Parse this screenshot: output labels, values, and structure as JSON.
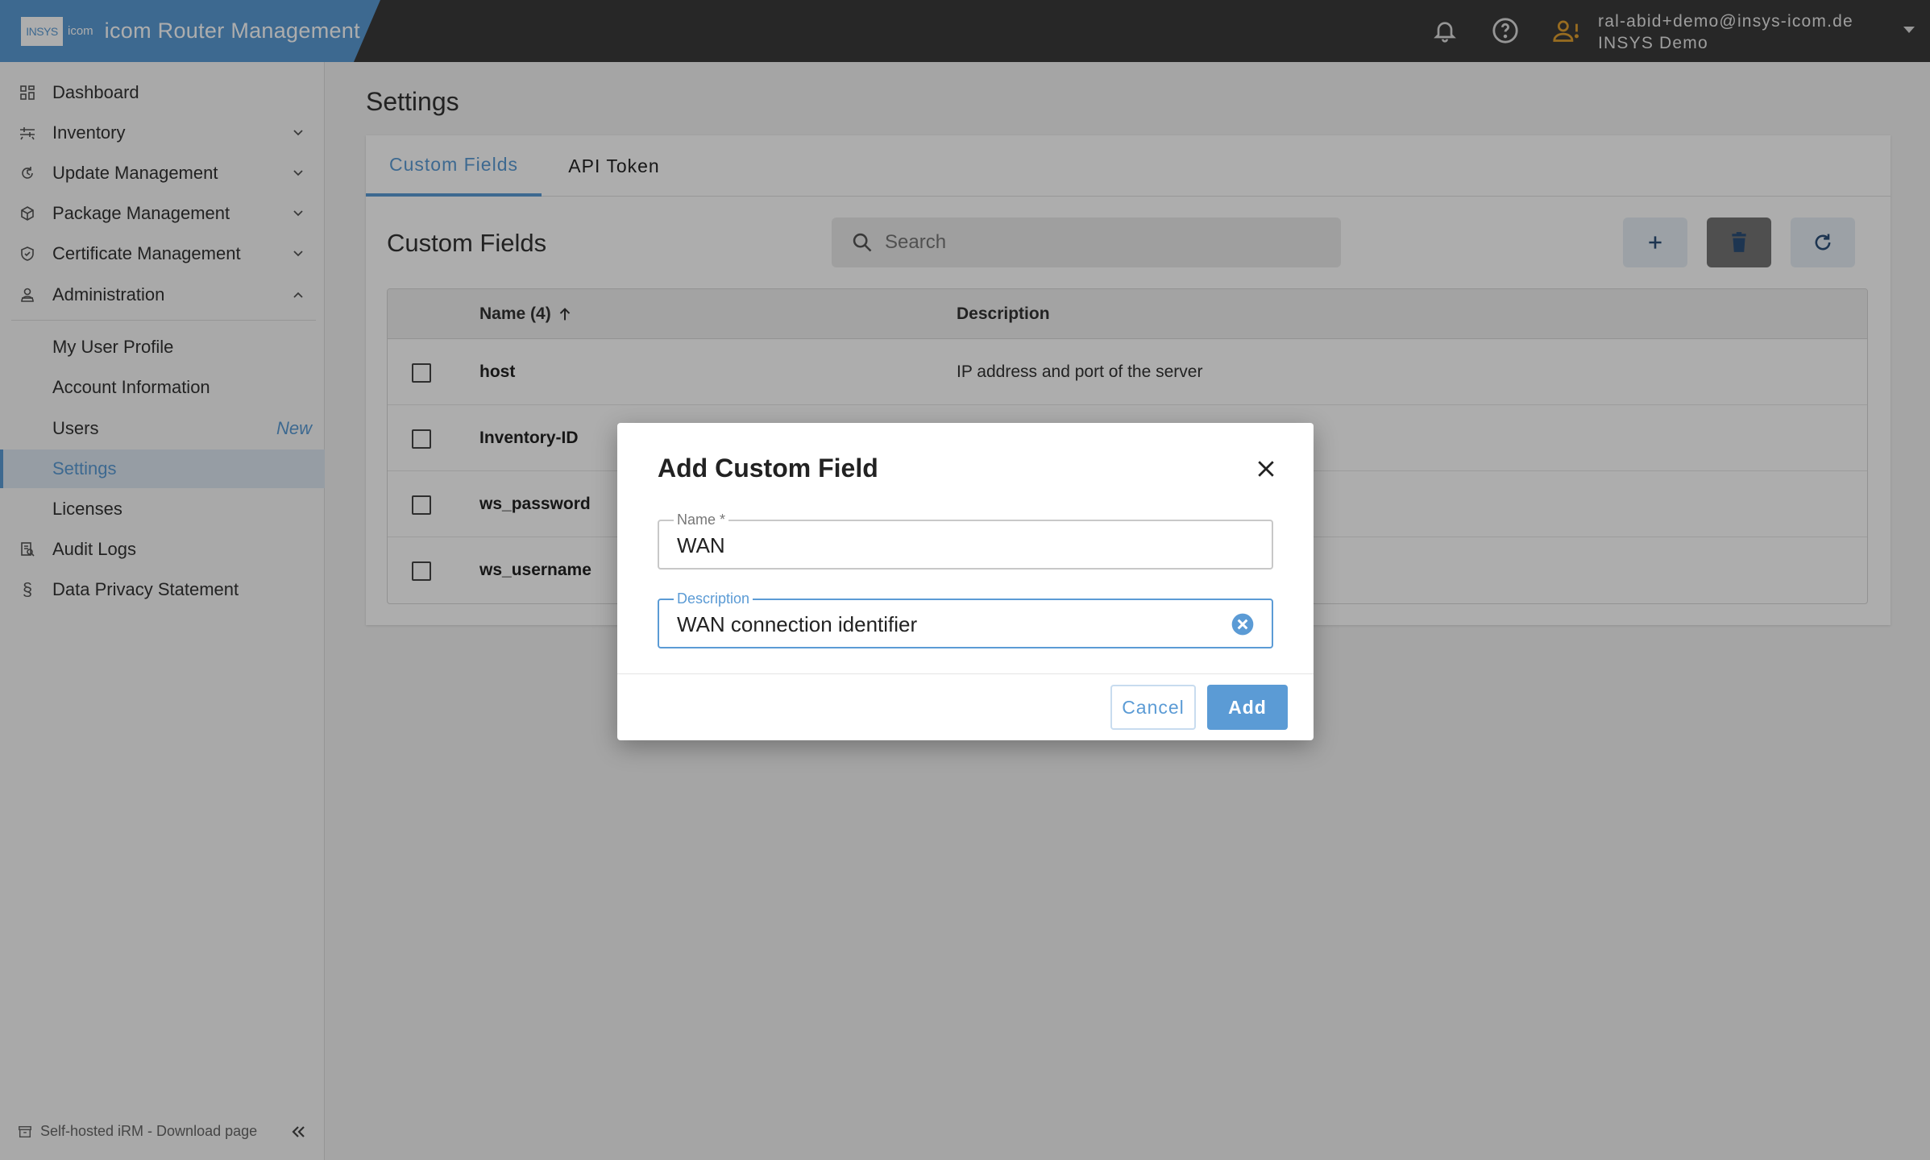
{
  "app": {
    "logo_text": "INSYS",
    "logo_sub": "icom",
    "title": "icom Router Management"
  },
  "header": {
    "user_email": "ral-abid+demo@insys-icom.de",
    "user_org": "INSYS Demo",
    "icons": [
      "bell-icon",
      "help-icon",
      "user-warning-icon",
      "caret-down-icon"
    ],
    "user_icon_color": "#e0a030"
  },
  "sidebar": {
    "items": [
      {
        "label": "Dashboard",
        "icon": "dashboard-icon"
      },
      {
        "label": "Inventory",
        "icon": "inventory-icon"
      },
      {
        "label": "Update Management",
        "icon": "update-icon"
      },
      {
        "label": "Package Management",
        "icon": "package-icon"
      },
      {
        "label": "Certificate Management",
        "icon": "certificate-icon"
      },
      {
        "label": "Administration",
        "icon": "admin-icon"
      }
    ],
    "admin_subitems": [
      {
        "label": "My User Profile"
      },
      {
        "label": "Account Information"
      },
      {
        "label": "Users",
        "badge": "New"
      },
      {
        "label": "Settings"
      },
      {
        "label": "Licenses"
      }
    ],
    "bottom_items": [
      {
        "label": "Audit Logs",
        "icon": "audit-icon"
      },
      {
        "label": "Data Privacy Statement",
        "icon": "paragraph-icon"
      }
    ],
    "footer_label": "Self-hosted iRM - Download page"
  },
  "main": {
    "page_title": "Settings",
    "tabs": [
      {
        "label": "Custom Fields",
        "active": true
      },
      {
        "label": "API Token",
        "active": false
      }
    ],
    "section_title": "Custom Fields",
    "search_placeholder": "Search",
    "table": {
      "columns": [
        "Name (4)",
        "Description"
      ],
      "rows": [
        {
          "name": "host",
          "description": "IP address and port of the server"
        },
        {
          "name": "Inventory-ID",
          "description": ""
        },
        {
          "name": "ws_password",
          "description": ""
        },
        {
          "name": "ws_username",
          "description": ""
        }
      ]
    }
  },
  "dialog": {
    "title": "Add Custom Field",
    "name_label": "Name *",
    "name_value": "WAN",
    "description_label": "Description",
    "description_value": "WAN connection identifier",
    "cancel_label": "Cancel",
    "add_label": "Add"
  },
  "colors": {
    "accent": "#5b9bd5",
    "header_bg": "#3a3a3a"
  }
}
